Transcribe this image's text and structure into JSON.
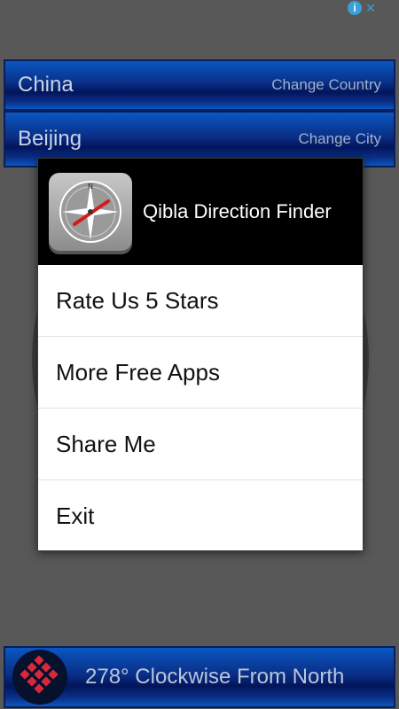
{
  "ad": {
    "info_icon": "info-icon",
    "close_icon": "close-icon"
  },
  "location": {
    "country": "China",
    "change_country_label": "Change Country",
    "city": "Beijing",
    "change_city_label": "Change City"
  },
  "dialog": {
    "app_title": "Qibla Direction Finder",
    "app_icon": "compass-icon",
    "items": [
      {
        "label": "Rate Us 5 Stars"
      },
      {
        "label": "More Free Apps"
      },
      {
        "label": "Share Me"
      },
      {
        "label": "Exit"
      }
    ]
  },
  "footer": {
    "direction_text": "278° Clockwise From North",
    "icon": "pattern-icon"
  },
  "colors": {
    "bar_blue": "#0a2f86",
    "backdrop": "#585858",
    "dialog_header": "#000000"
  }
}
